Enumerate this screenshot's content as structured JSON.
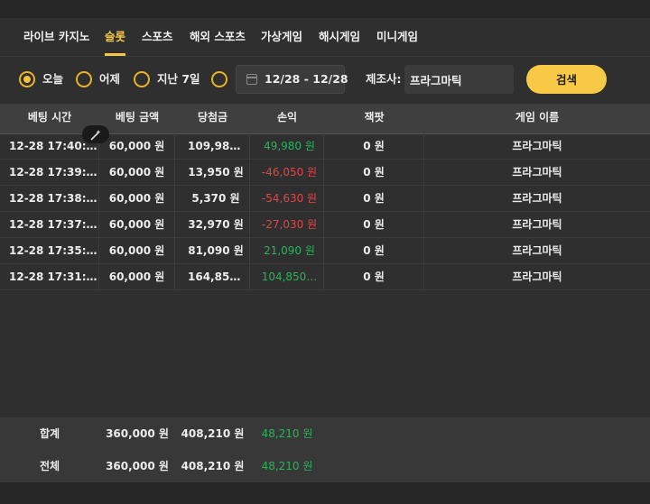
{
  "tabs": [
    "라이브 카지노",
    "슬롯",
    "스포츠",
    "해외 스포츠",
    "가상게임",
    "해시게임",
    "미니게임"
  ],
  "active_tab": "슬롯",
  "filters": {
    "radios": [
      "오늘",
      "어제",
      "지난 7일",
      ""
    ],
    "selected": "오늘",
    "date_range": "12/28 - 12/28",
    "provider_label": "제조사:",
    "provider_value": "프라그마틱",
    "search_label": "검색"
  },
  "columns": [
    "베팅 시간",
    "베팅 금액",
    "당첨금",
    "손익",
    "잭팟",
    "게임 이름"
  ],
  "rows": [
    {
      "time": "12-28 17:40:…",
      "bet": "60,000 원",
      "win": "109,980…",
      "pl": "49,980 원",
      "pl_sign": "pos",
      "jackpot": "0 원",
      "game": "프라그마틱"
    },
    {
      "time": "12-28 17:39:…",
      "bet": "60,000 원",
      "win": "13,950 원",
      "pl": "-46,050 원",
      "pl_sign": "neg",
      "jackpot": "0 원",
      "game": "프라그마틱"
    },
    {
      "time": "12-28 17:38:…",
      "bet": "60,000 원",
      "win": "5,370 원",
      "pl": "-54,630 원",
      "pl_sign": "neg",
      "jackpot": "0 원",
      "game": "프라그마틱"
    },
    {
      "time": "12-28 17:37:…",
      "bet": "60,000 원",
      "win": "32,970 원",
      "pl": "-27,030 원",
      "pl_sign": "neg",
      "jackpot": "0 원",
      "game": "프라그마틱"
    },
    {
      "time": "12-28 17:35:…",
      "bet": "60,000 원",
      "win": "81,090 원",
      "pl": "21,090 원",
      "pl_sign": "pos",
      "jackpot": "0 원",
      "game": "프라그마틱"
    },
    {
      "time": "12-28 17:31:…",
      "bet": "60,000 원",
      "win": "164,850…",
      "pl": "104,850…",
      "pl_sign": "pos",
      "jackpot": "0 원",
      "game": "프라그마틱"
    }
  ],
  "summary": [
    {
      "label": "합계",
      "bet": "360,000 원",
      "win": "408,210 원",
      "pl": "48,210 원"
    },
    {
      "label": "전체",
      "bet": "360,000 원",
      "win": "408,210 원",
      "pl": "48,210 원"
    }
  ],
  "colors": {
    "accent": "#f5c84a",
    "positive": "#28b45a",
    "negative": "#e04646"
  },
  "icons": {
    "calendar": "calendar-icon",
    "magic_wand": "magic-wand-icon"
  }
}
